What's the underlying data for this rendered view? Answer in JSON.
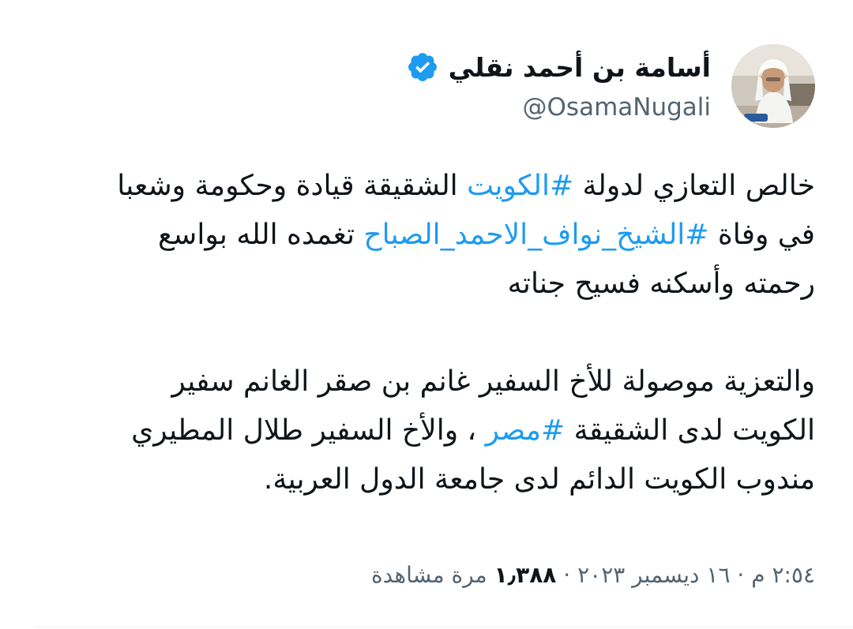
{
  "author": {
    "display_name": "أسامة بن أحمد نقلي",
    "handle": "@OsamaNugali",
    "verified_icon": "verified-badge-icon",
    "avatar_icon": "profile-photo"
  },
  "tweet": {
    "paragraph1": {
      "line1": {
        "before": "خالص التعازي لدولة ",
        "hashtag": "#الكويت",
        "after": " الشقيقة قيادة وحكومة وشعبا"
      },
      "line2": {
        "before": "في وفاة ",
        "hashtag": "#الشيخ_نواف_الاحمد_الصباح",
        "after": " تغمده الله بواسع"
      },
      "line3": "رحمته وأسكنه فسيح جناته"
    },
    "paragraph2": {
      "line1": "والتعزية موصولة للأخ السفير غانم  بن صقر الغانم  سفير",
      "line2": {
        "before": "الكويت لدى الشقيقة ",
        "hashtag": "#مصر",
        "after": " ، والأخ السفير طلال المطيري"
      },
      "line3": "مندوب الكويت الدائم لدى جامعة الدول العربية."
    }
  },
  "meta": {
    "time": "٢:٥٤ م",
    "separator": " · ",
    "date": "١٦ ديسمبر ٢٠٢٣",
    "views_count": "١٫٣٨٨",
    "views_label": " مرة مشاهدة"
  },
  "colors": {
    "hashtag": "#1d9bf0",
    "text": "#0f1419",
    "secondary": "#536471",
    "verified": "#1d9bf0"
  }
}
